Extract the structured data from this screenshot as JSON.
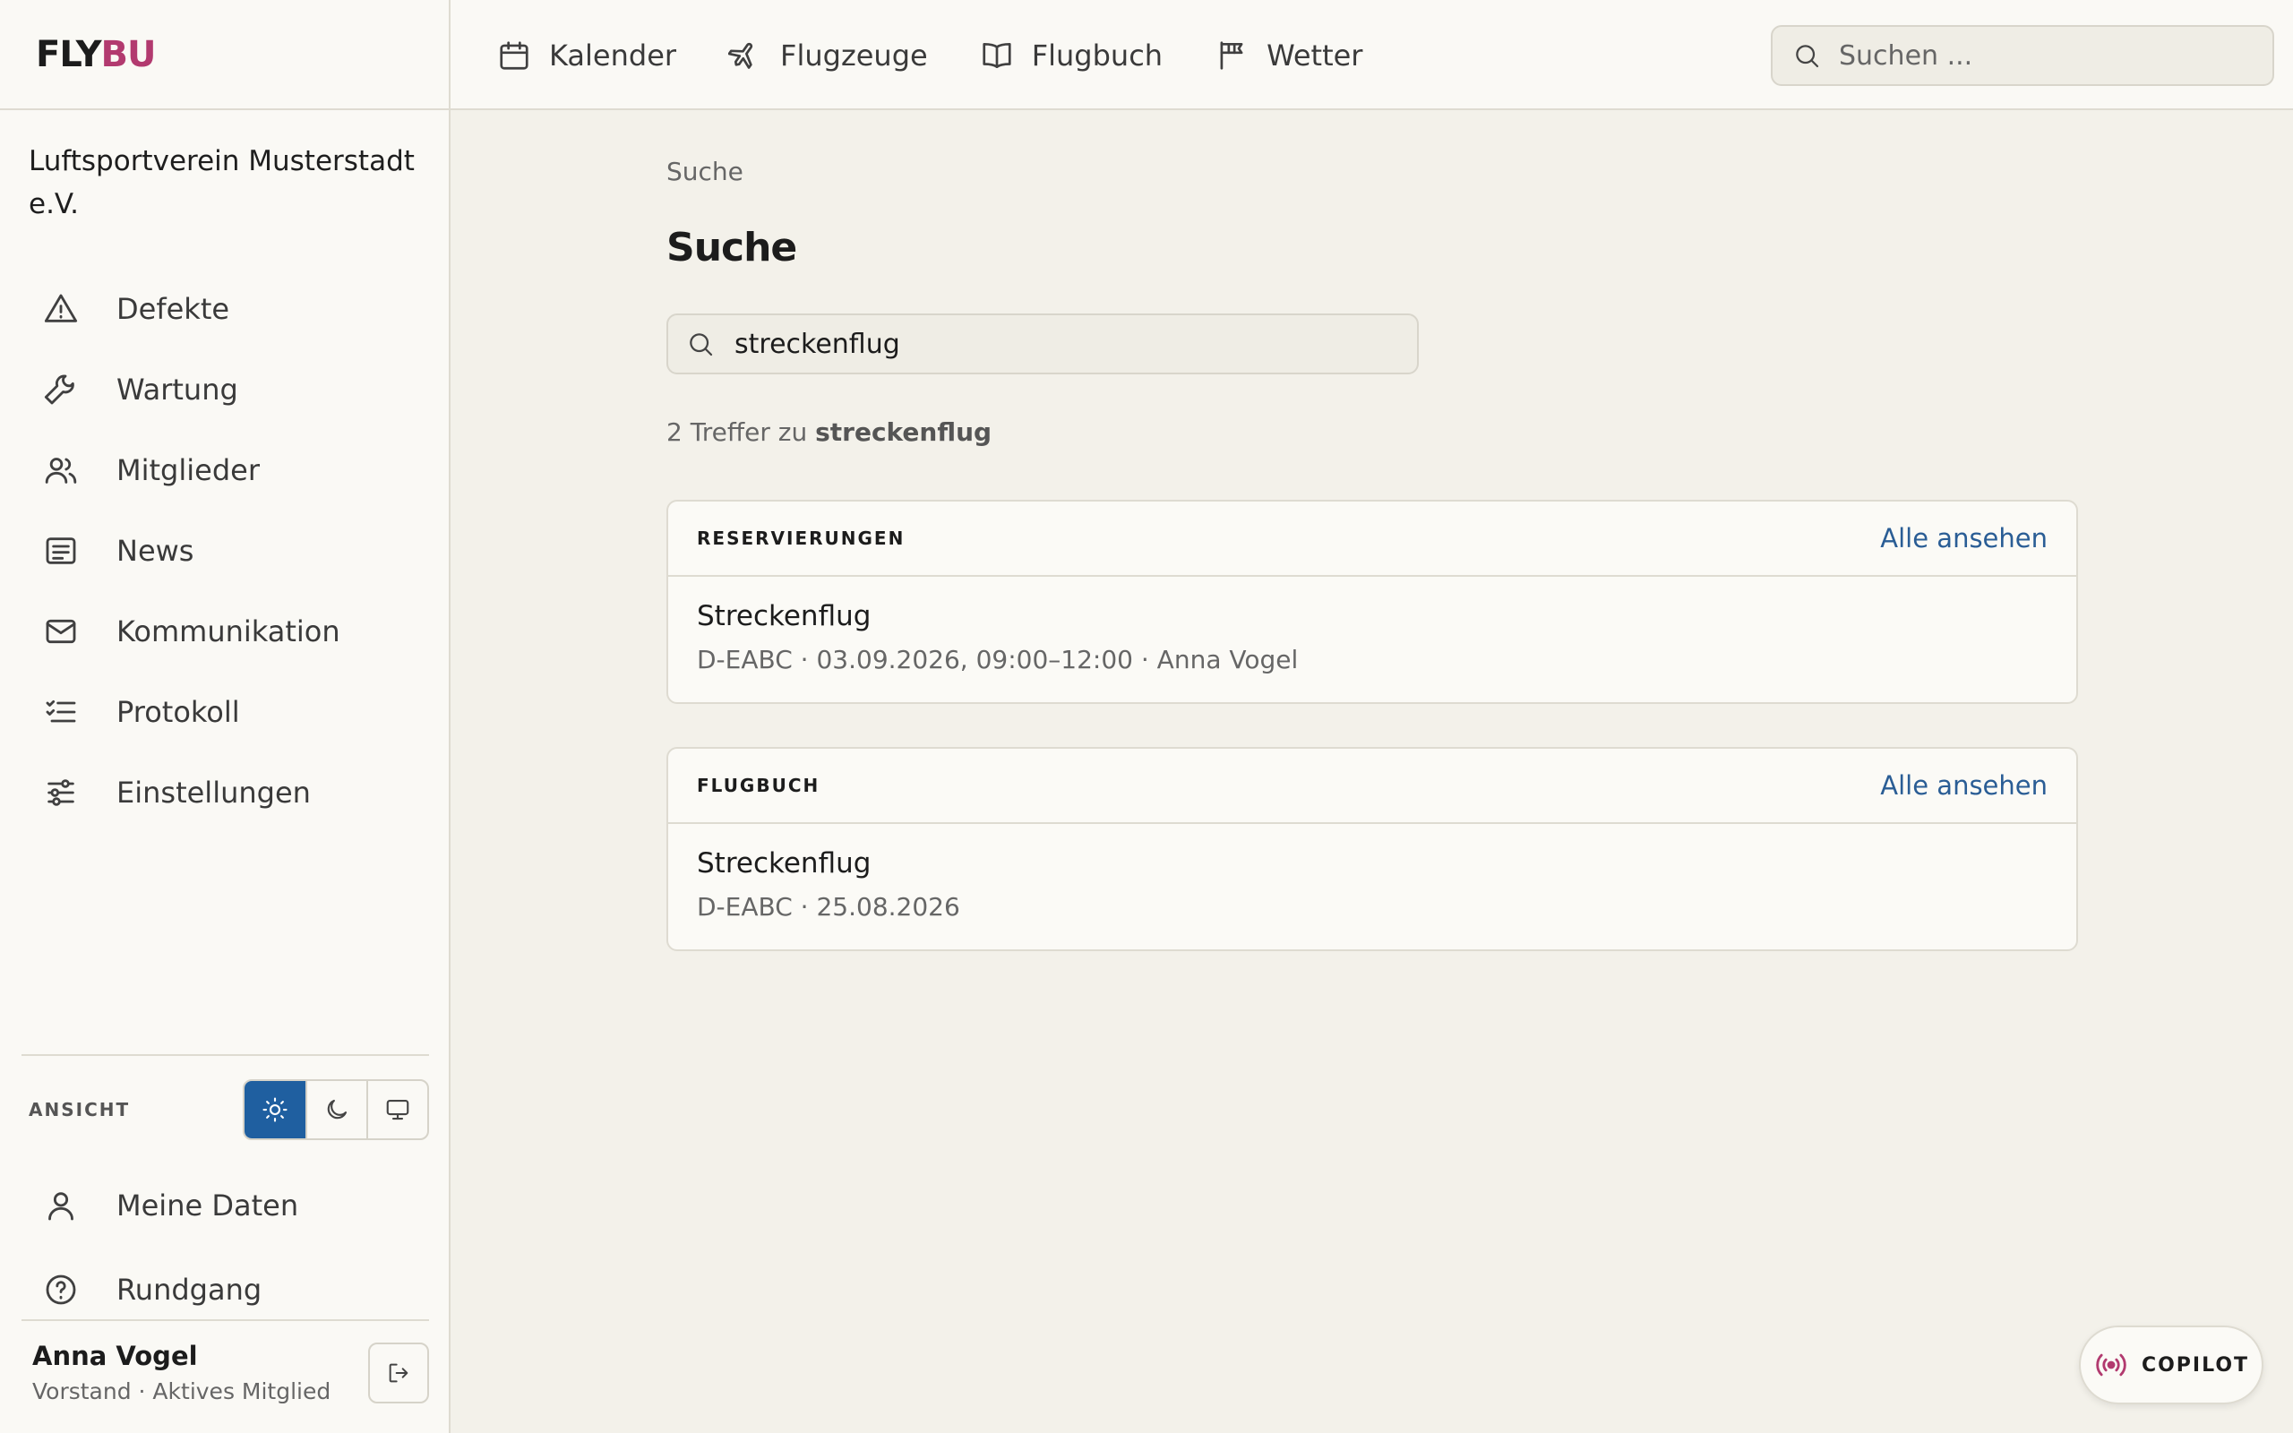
{
  "logo": {
    "part1": "FLY",
    "part2": "BU"
  },
  "org_name": "Luftsportverein Musterstadt e.V.",
  "sidebar": {
    "items": [
      {
        "label": "Defekte",
        "icon": "warning-icon"
      },
      {
        "label": "Wartung",
        "icon": "wrench-icon"
      },
      {
        "label": "Mitglieder",
        "icon": "users-icon"
      },
      {
        "label": "News",
        "icon": "newspaper-icon"
      },
      {
        "label": "Kommunikation",
        "icon": "mail-icon"
      },
      {
        "label": "Protokoll",
        "icon": "list-check-icon"
      },
      {
        "label": "Einstellungen",
        "icon": "sliders-icon"
      }
    ],
    "ansicht_label": "ANSICHT",
    "theme_selected": "light",
    "bottom_items": [
      {
        "label": "Meine Daten",
        "icon": "user-icon"
      },
      {
        "label": "Rundgang",
        "icon": "help-circle-icon"
      }
    ]
  },
  "user": {
    "name": "Anna Vogel",
    "role": "Vorstand · Aktives Mitglied"
  },
  "topnav": [
    {
      "label": "Kalender",
      "icon": "calendar-icon"
    },
    {
      "label": "Flugzeuge",
      "icon": "plane-icon"
    },
    {
      "label": "Flugbuch",
      "icon": "book-icon"
    },
    {
      "label": "Wetter",
      "icon": "windsock-icon"
    }
  ],
  "top_search": {
    "placeholder": "Suchen ..."
  },
  "main": {
    "breadcrumb": "Suche",
    "title": "Suche",
    "search_value": "streckenflug",
    "result_prefix": "2 Treffer zu ",
    "result_term": "streckenflug",
    "sections": [
      {
        "title": "RESERVIERUNGEN",
        "link": "Alle ansehen",
        "items": [
          {
            "title": "Streckenflug",
            "meta": "D-EABC · 03.09.2026, 09:00–12:00 · Anna Vogel"
          }
        ]
      },
      {
        "title": "FLUGBUCH",
        "link": "Alle ansehen",
        "items": [
          {
            "title": "Streckenflug",
            "meta": "D-EABC · 25.08.2026"
          }
        ]
      }
    ]
  },
  "copilot": {
    "label": "COPILOT"
  },
  "colors": {
    "accent": "#1f5fa0",
    "brand": "#b23a6f",
    "link": "#2a5d95",
    "background": "#f3f1ea"
  }
}
